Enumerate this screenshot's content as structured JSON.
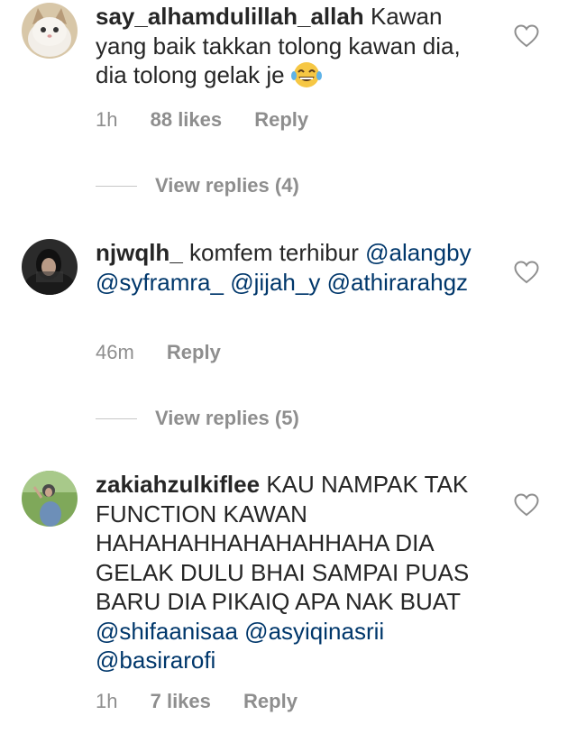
{
  "comments": [
    {
      "username": "say_alhamdulillah_allah",
      "text_before_emoji": "Kawan yang baik takkan tolong kawan dia, dia tolong gelak je",
      "emoji": "face-with-tears-of-joy",
      "time": "1h",
      "likes": "88 likes",
      "reply": "Reply",
      "view_replies": "View replies (4)"
    },
    {
      "username": "njwqlh_",
      "text": "komfem terhibur",
      "mentions": [
        "@alangby",
        "@syframra_",
        "@jijah_y",
        "@athirarahgz"
      ],
      "time": "46m",
      "reply": "Reply",
      "view_replies": "View replies (5)"
    },
    {
      "username": "zakiahzulkiflee",
      "text": "KAU NAMPAK TAK FUNCTION KAWAN HAHAHAHHAHAHAHHAHA DIA GELAK DULU BHAI SAMPAI PUAS BARU DIA PIKAIQ APA NAK BUAT",
      "mentions": [
        "@shifaanisaa",
        "@asyiqinasrii",
        "@basirarofi"
      ],
      "time": "1h",
      "likes": "7 likes",
      "reply": "Reply"
    }
  ],
  "colors": {
    "text": "#262626",
    "secondary": "#8e8e8e",
    "mention": "#00376b",
    "divider": "#c7c7c7"
  },
  "icons": {
    "like": "heart-outline-icon"
  }
}
